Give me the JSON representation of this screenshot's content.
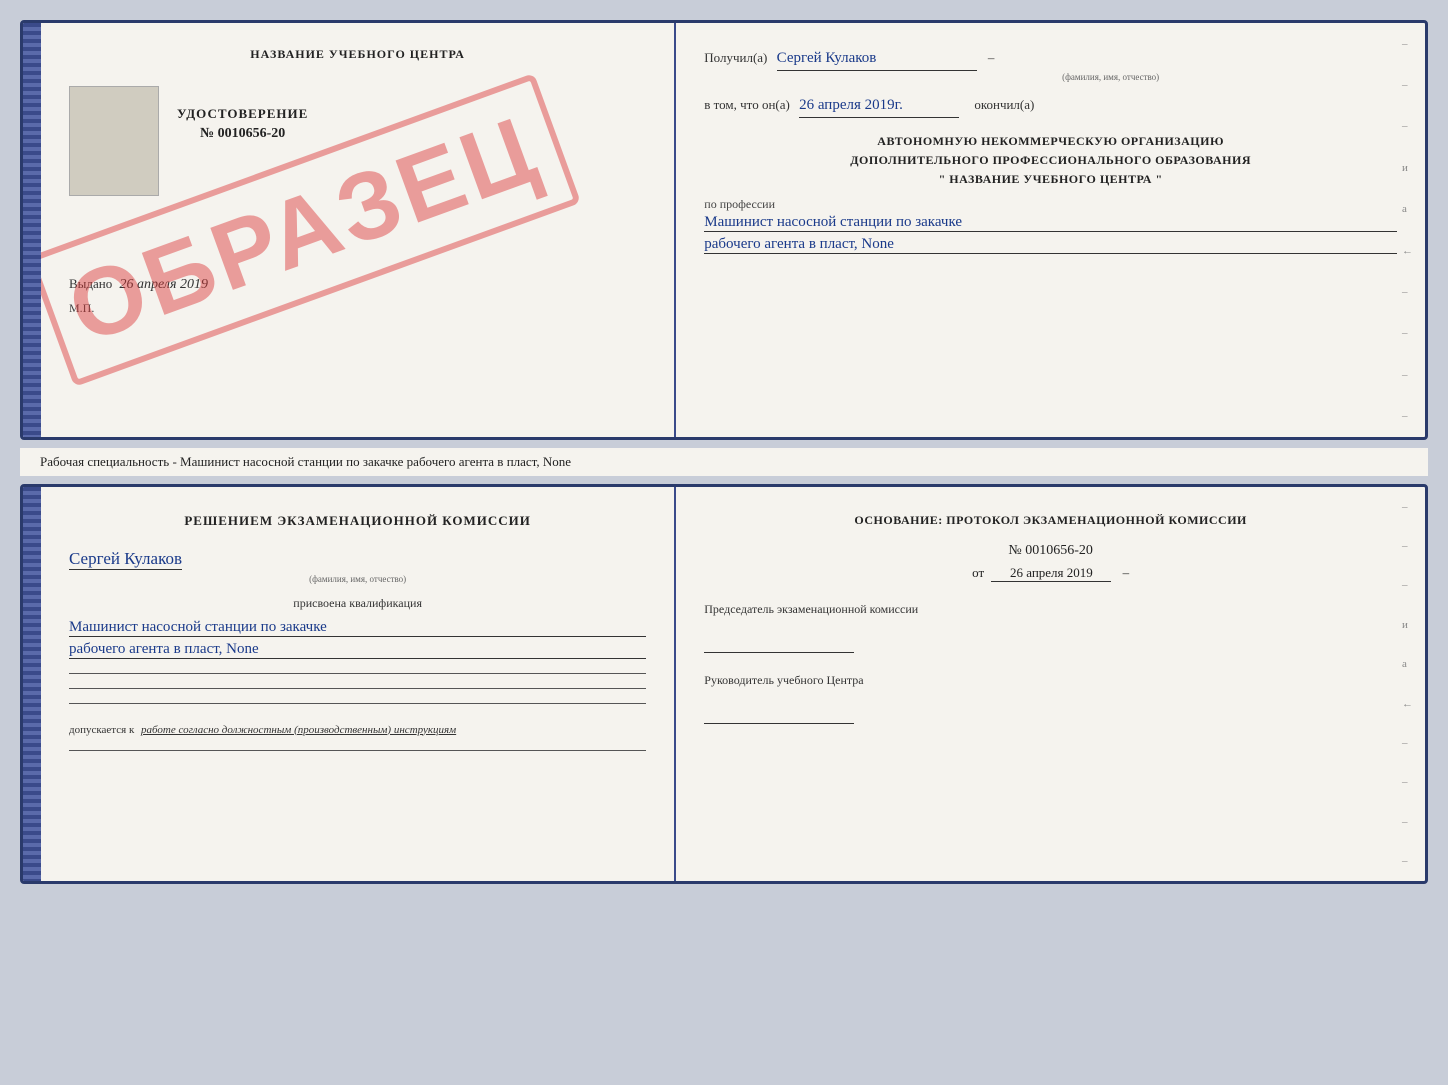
{
  "top_certificate": {
    "left": {
      "title": "НАЗВАНИЕ УЧЕБНОГО ЦЕНТРА",
      "watermark": "ОБРАЗЕЦ",
      "udostoverenie_label": "УДОСТОВЕРЕНИЕ",
      "number": "№ 0010656-20",
      "vydano_label": "Выдано",
      "vydano_date": "26 апреля 2019",
      "mp_label": "М.П."
    },
    "right": {
      "poluchil_label": "Получил(а)",
      "poluchil_name": "Сергей Кулаков",
      "familiya_hint": "(фамилия, имя, отчество)",
      "vtom_label": "в том, что он(а)",
      "vtom_date": "26 апреля 2019г.",
      "okonchil_label": "окончил(а)",
      "org_line1": "АВТОНОМНУЮ НЕКОММЕРЧЕСКУЮ ОРГАНИЗАЦИЮ",
      "org_line2": "ДОПОЛНИТЕЛЬНОГО ПРОФЕССИОНАЛЬНОГО ОБРАЗОВАНИЯ",
      "org_line3": "\"  НАЗВАНИЕ УЧЕБНОГО ЦЕНТРА  \"",
      "po_professii_label": "по профессии",
      "profession_line1": "Машинист насосной станции по закачке",
      "profession_line2": "рабочего агента в пласт, None",
      "side_chars": [
        "–",
        "–",
        "–",
        "и",
        "а",
        "←",
        "–",
        "–",
        "–",
        "–"
      ]
    }
  },
  "middle_text": "Рабочая специальность - Машинист насосной станции по закачке рабочего агента в пласт,\nNone",
  "bottom_certificate": {
    "left": {
      "komissia_title": "Решением экзаменационной комиссии",
      "name": "Сергей Кулаков",
      "name_hint": "(фамилия, имя, отчество)",
      "prisvoena_label": "присвоена квалификация",
      "qualification_line1": "Машинист насосной станции по закачке",
      "qualification_line2": "рабочего агента в пласт, None",
      "underlines": [
        "",
        "",
        ""
      ],
      "dopuskaetsya_label": "допускается к",
      "dopuskaetsya_work": "работе согласно должностным (производственным) инструкциям",
      "bottom_line": ""
    },
    "right": {
      "osnование_title": "Основание: протокол экзаменационной комиссии",
      "protocol_number": "№ 0010656-20",
      "protocol_from_label": "от",
      "protocol_date": "26 апреля 2019",
      "predsedatel_title": "Председатель экзаменационной комиссии",
      "rukovoditel_title": "Руководитель учебного Центра",
      "side_chars": [
        "–",
        "–",
        "–",
        "и",
        "а",
        "←",
        "–",
        "–",
        "–",
        "–"
      ]
    }
  }
}
